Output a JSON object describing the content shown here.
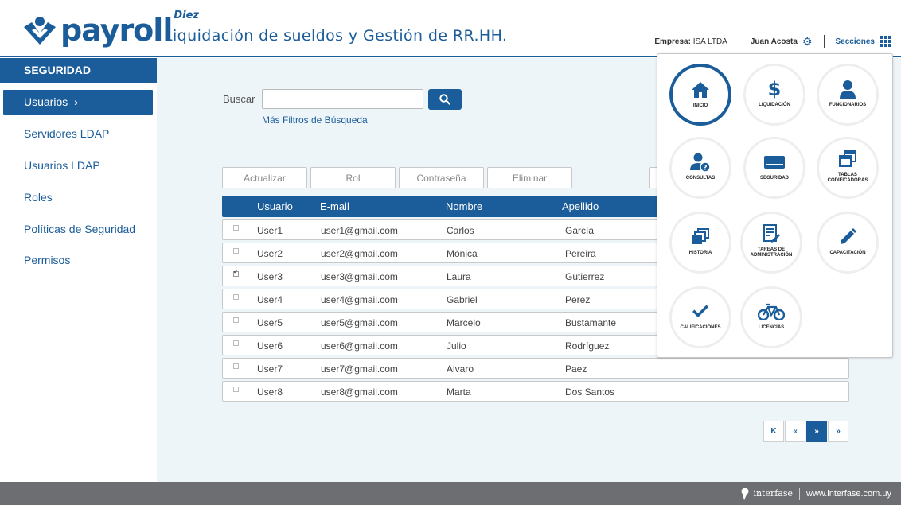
{
  "brand": {
    "logo_text": "payroll",
    "logo_superscript": "Diez",
    "app_title": "Liquidación de sueldos y Gestión de RR.HH.",
    "primary_color": "#1b5d9a"
  },
  "header": {
    "company_label": "Empresa:",
    "company_value": "ISA LTDA",
    "user_name": "Juan Acosta",
    "sections_label": "Secciones"
  },
  "sidebar": {
    "heading": "SEGURIDAD",
    "items": [
      {
        "label": "Usuarios",
        "active": true
      },
      {
        "label": "Servidores LDAP",
        "active": false
      },
      {
        "label": "Usuarios LDAP",
        "active": false
      },
      {
        "label": "Roles",
        "active": false
      },
      {
        "label": "Políticas de Seguridad",
        "active": false
      },
      {
        "label": "Permisos",
        "active": false
      }
    ]
  },
  "search": {
    "label": "Buscar",
    "value": "",
    "placeholder": "",
    "more_filters": "Más Filtros de Búsqueda"
  },
  "toolbar": {
    "update": "Actualizar",
    "role": "Rol",
    "password": "Contraseña",
    "delete": "Eliminar"
  },
  "table": {
    "columns": [
      "Usuario",
      "E-mail",
      "Nombre",
      "Apellido"
    ],
    "rows": [
      {
        "checked": false,
        "user": "User1",
        "email": "user1@gmail.com",
        "first": "Carlos",
        "last": "García"
      },
      {
        "checked": false,
        "user": "User2",
        "email": "user2@gmail.com",
        "first": "Mónica",
        "last": "Pereira"
      },
      {
        "checked": true,
        "user": "User3",
        "email": "user3@gmail.com",
        "first": "Laura",
        "last": "Gutierrez"
      },
      {
        "checked": false,
        "user": "User4",
        "email": "user4@gmail.com",
        "first": "Gabriel",
        "last": "Perez"
      },
      {
        "checked": false,
        "user": "User5",
        "email": "user5@gmail.com",
        "first": "Marcelo",
        "last": "Bustamante"
      },
      {
        "checked": false,
        "user": "User6",
        "email": "user6@gmail.com",
        "first": "Julio",
        "last": "Rodríguez"
      },
      {
        "checked": false,
        "user": "User7",
        "email": "user7@gmail.com",
        "first": "Alvaro",
        "last": "Paez"
      },
      {
        "checked": false,
        "user": "User8",
        "email": "user8@gmail.com",
        "first": "Marta",
        "last": "Dos Santos"
      }
    ]
  },
  "pagination": {
    "first": "K",
    "prev": "«",
    "next": "»",
    "last": "»"
  },
  "sections_menu": [
    {
      "label": "INICIO",
      "icon": "home-icon",
      "active": true
    },
    {
      "label": "LIQUIDACIÓN",
      "icon": "dollar-icon",
      "active": false
    },
    {
      "label": "FUNCIONARIOS",
      "icon": "person-icon",
      "active": false
    },
    {
      "label": "CONSULTAS",
      "icon": "person-question-icon",
      "active": false
    },
    {
      "label": "SEGURIDAD",
      "icon": "drive-icon",
      "active": false
    },
    {
      "label": "TABLAS CODIFICADORAS",
      "icon": "stacked-windows-icon",
      "active": false
    },
    {
      "label": "HISTORIA",
      "icon": "stacked-pages-icon",
      "active": false
    },
    {
      "label": "TAREAS DE ADMINISTRACIÓN",
      "icon": "document-edit-icon",
      "active": false
    },
    {
      "label": "CAPACITACIÓN",
      "icon": "pencil-icon",
      "active": false
    },
    {
      "label": "CALIFICACIONES",
      "icon": "check-icon",
      "active": false
    },
    {
      "label": "LICENCIAS",
      "icon": "bicycle-icon",
      "active": false
    }
  ],
  "footer": {
    "brand": "interfase",
    "url": "www.interfase.com.uy"
  }
}
